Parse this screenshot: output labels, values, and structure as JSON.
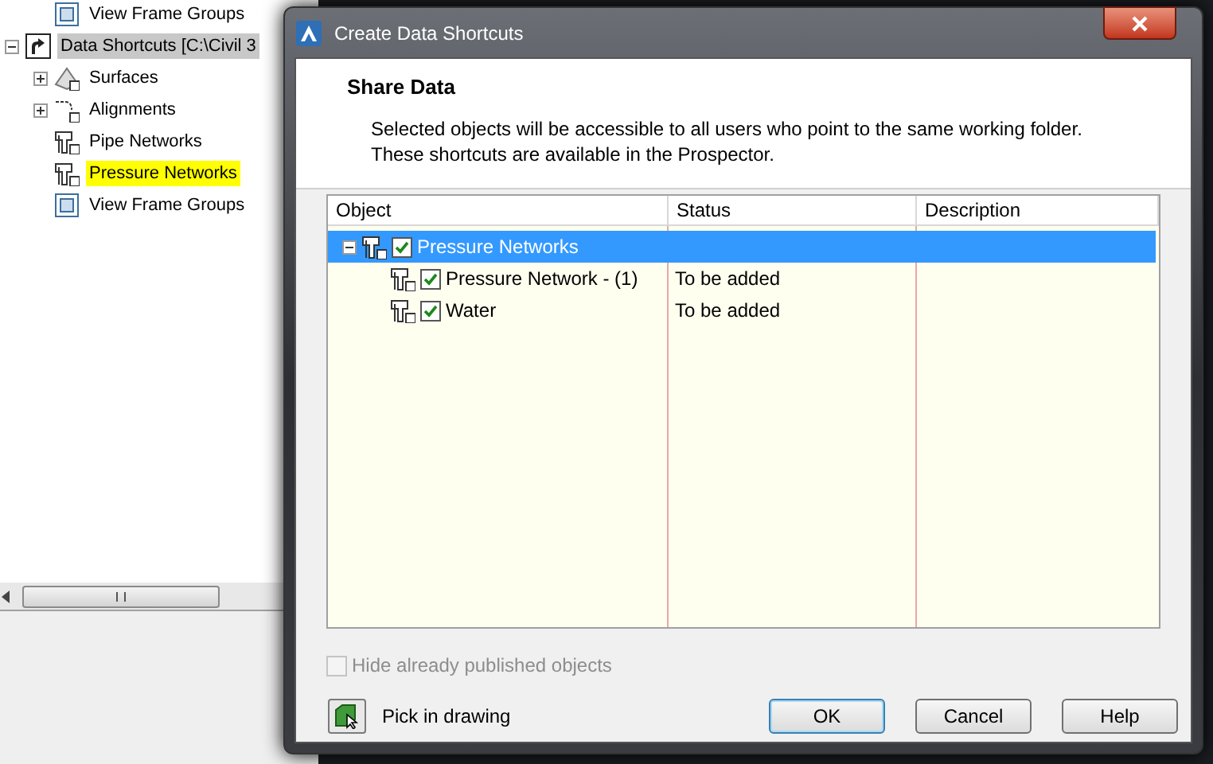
{
  "prospector": {
    "tree": [
      {
        "children": [
          {
            "label": "View Frame Groups",
            "kind": "frames",
            "highlighted": false
          }
        ]
      },
      {
        "label": "Data Shortcuts [C:\\Civil 3",
        "kind": "shortcut",
        "expanded": true,
        "selected": true,
        "highlighted": false,
        "children": [
          {
            "label": "Surfaces",
            "kind": "surface",
            "expanded": false,
            "highlighted": false
          },
          {
            "label": "Alignments",
            "kind": "alignment",
            "expanded": false,
            "highlighted": false
          },
          {
            "label": "Pipe Networks",
            "kind": "pipe",
            "highlighted": false
          },
          {
            "label": "Pressure Networks",
            "kind": "pipe",
            "highlighted": true
          },
          {
            "label": "View Frame Groups",
            "kind": "frames",
            "highlighted": false
          }
        ]
      }
    ]
  },
  "dialog": {
    "title": "Create Data Shortcuts",
    "heading": "Share Data",
    "description": "Selected objects will be accessible to all users who point to the same working folder.\nThese shortcuts are available in the Prospector.",
    "table": {
      "columns": [
        "Object",
        "Status",
        "Description"
      ],
      "rows": [
        {
          "object": "Pressure Networks",
          "status": "",
          "checked": true,
          "selected": true,
          "expanded": true,
          "children": [
            {
              "object": "Pressure Network - (1)",
              "status": "To be added",
              "checked": true,
              "selected": false
            },
            {
              "object": "Water",
              "status": "To be added",
              "checked": true,
              "selected": false
            }
          ]
        }
      ]
    },
    "hide_published": {
      "label": "Hide already published objects",
      "checked": false,
      "disabled": true
    },
    "pick_label": "Pick in drawing",
    "buttons": [
      {
        "label": "OK",
        "default": true
      },
      {
        "label": "Cancel",
        "default": false
      },
      {
        "label": "Help",
        "default": false
      }
    ]
  }
}
